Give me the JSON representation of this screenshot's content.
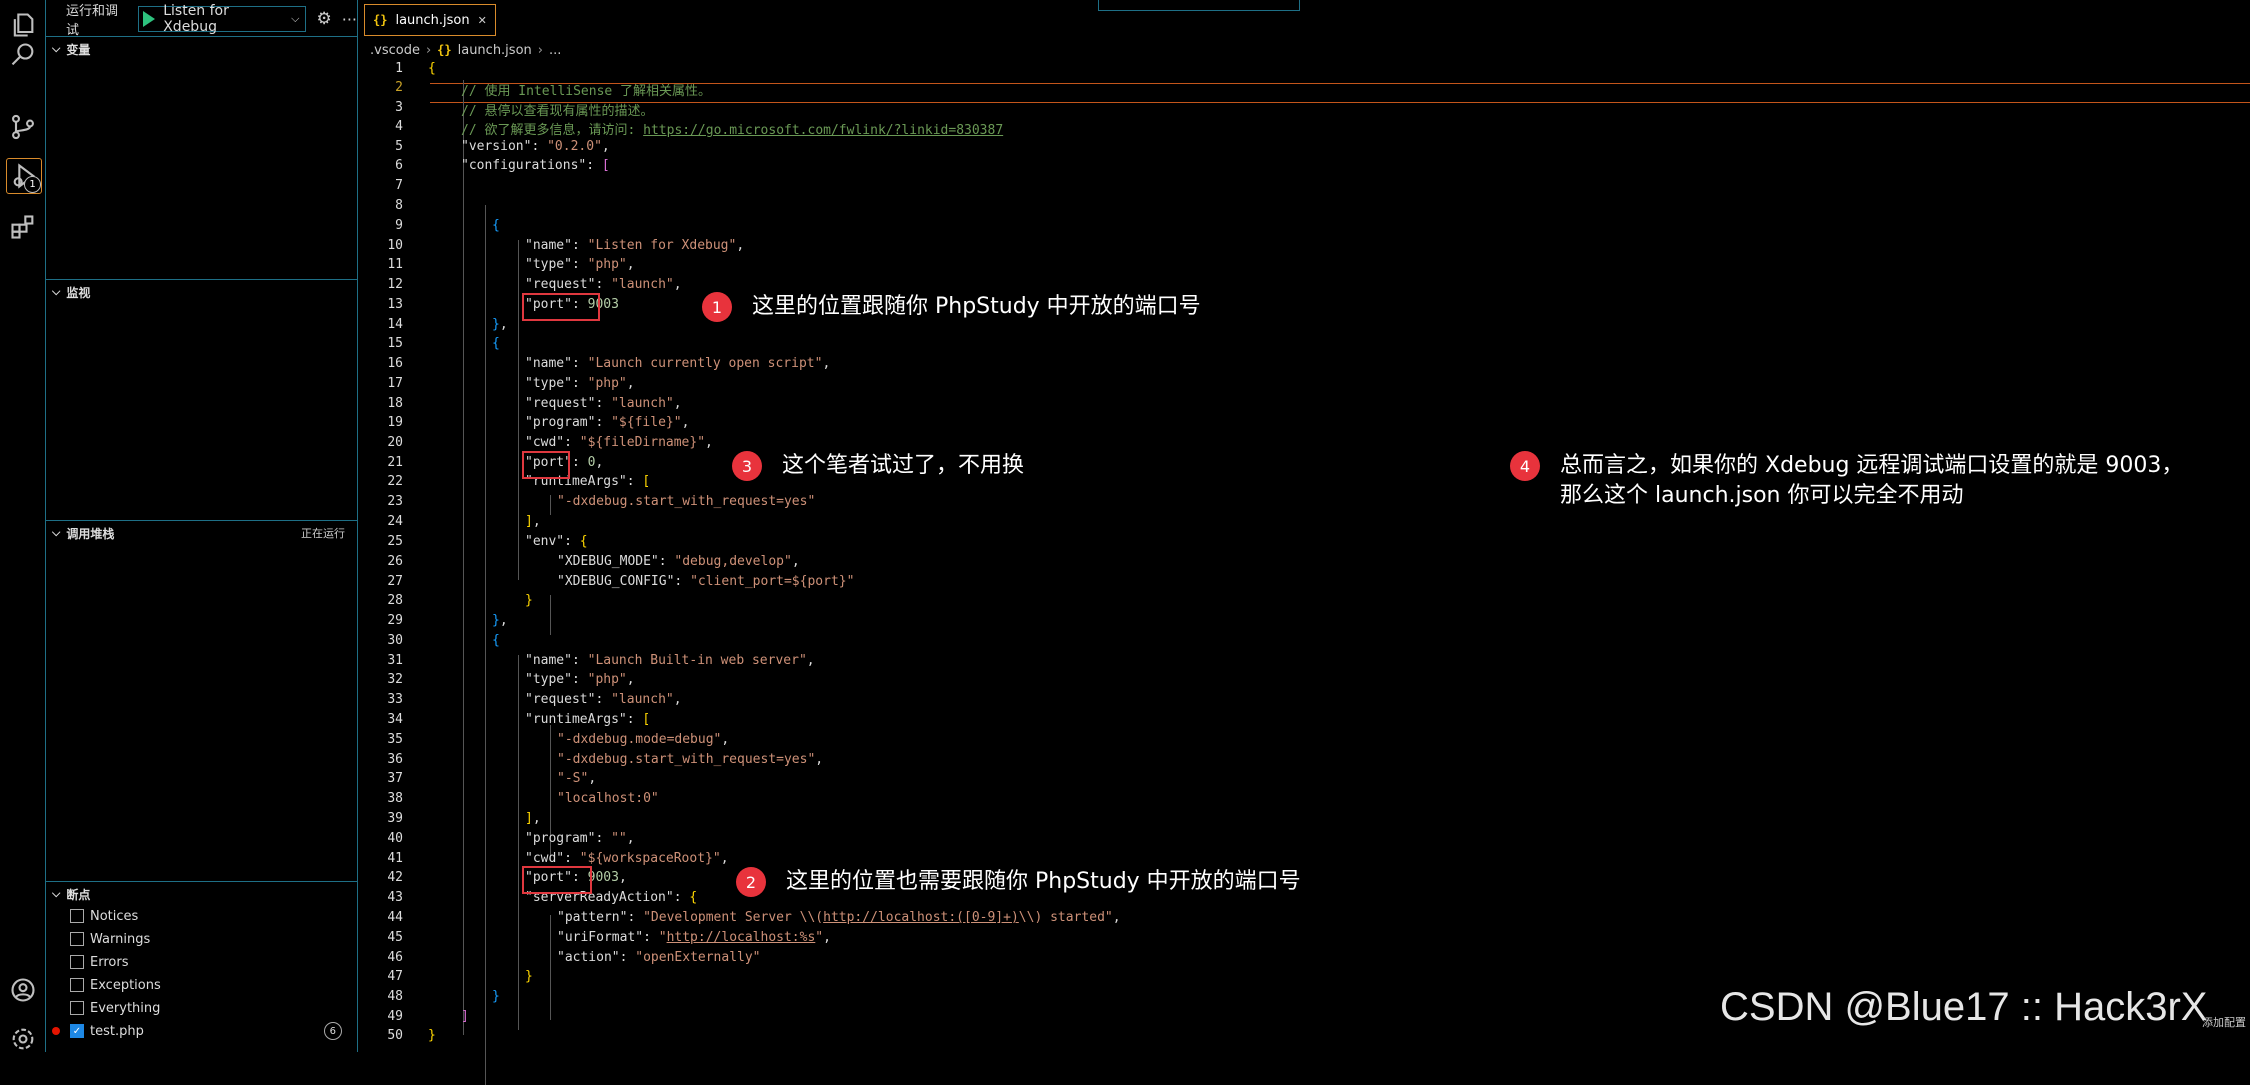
{
  "sidebar": {
    "title": "运行和调试",
    "config_selected": "Listen for Xdebug",
    "sections": {
      "variables": "变量",
      "watch": "监视",
      "callstack": "调用堆栈",
      "callstack_status": "正在运行",
      "breakpoints": "断点"
    },
    "breakpoints": [
      {
        "label": "Notices",
        "checked": false
      },
      {
        "label": "Warnings",
        "checked": false
      },
      {
        "label": "Errors",
        "checked": false
      },
      {
        "label": "Exceptions",
        "checked": false
      },
      {
        "label": "Everything",
        "checked": false
      },
      {
        "label": "test.php",
        "checked": true,
        "count": "6"
      }
    ]
  },
  "activity_icons": [
    "explorer-icon",
    "search-icon",
    "source-control-icon",
    "run-debug-icon",
    "extensions-icon",
    "account-icon",
    "settings-gear-icon"
  ],
  "activity_badge": "1",
  "editor": {
    "tab": {
      "icon": "{}",
      "label": "launch.json",
      "close": "✕"
    },
    "breadcrumb": [
      ".vscode",
      "launch.json",
      "..."
    ],
    "line_numbers": [
      "1",
      "2",
      "3",
      "4",
      "5",
      "6",
      "7",
      "8",
      "9",
      "10",
      "11",
      "12",
      "13",
      "14",
      "15",
      "16",
      "17",
      "18",
      "19",
      "20",
      "21",
      "22",
      "23",
      "24",
      "25",
      "26",
      "27",
      "28",
      "29",
      "30",
      "31",
      "32",
      "33",
      "34",
      "35",
      "36",
      "37",
      "38",
      "39",
      "40",
      "41",
      "42",
      "43",
      "44",
      "45",
      "46",
      "47",
      "48",
      "49",
      "50"
    ]
  },
  "annotations": [
    {
      "num": "1",
      "text": "这里的位置跟随你 PhpStudy 中开放的端口号"
    },
    {
      "num": "3",
      "text": "这个笔者试过了，不用换"
    },
    {
      "num": "4",
      "text": "总而言之，如果你的 Xdebug 远程调试端口设置的就是 9003，\n那么这个 launch.json 你可以完全不用动"
    },
    {
      "num": "2",
      "text": "这里的位置也需要跟随你 PhpStudy 中开放的端口号"
    }
  ],
  "watermark": "CSDN @Blue17 :: Hack3rX",
  "corner_label": "添加配置"
}
